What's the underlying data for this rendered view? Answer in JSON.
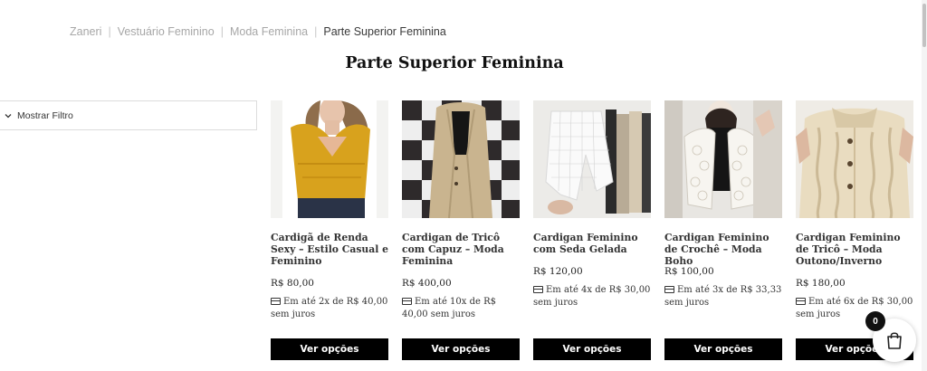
{
  "breadcrumb": {
    "items": [
      "Zaneri",
      "Vestuário Feminino",
      "Moda Feminina"
    ],
    "current": "Parte Superior Feminina",
    "separator": "|"
  },
  "page_title": "Parte Superior Feminina",
  "filter": {
    "label": "Mostrar Filtro",
    "icon": "chevron-down-icon"
  },
  "products": [
    {
      "name": "Cardigã de Renda Sexy – Estilo Casual e Feminino",
      "price": "R$ 80,00",
      "installment": "Em até 2x de R$ 40,00 sem juros",
      "button": "Ver opções"
    },
    {
      "name": "Cardigan de Tricô com Capuz – Moda Feminina",
      "price": "R$ 400,00",
      "installment": "Em até 10x de R$ 40,00 sem juros",
      "button": "Ver opções"
    },
    {
      "name": "Cardigan Feminino com Seda Gelada",
      "price": "R$ 120,00",
      "installment": "Em até 4x de R$ 30,00 sem juros",
      "button": "Ver opções"
    },
    {
      "name": "Cardigan Feminino de Crochê – Moda Boho",
      "price": "R$ 100,00",
      "installment": "Em até 3x de R$ 33,33 sem juros",
      "button": "Ver opções"
    },
    {
      "name": "Cardigan Feminino de Tricô – Moda Outono/Inverno",
      "price": "R$ 180,00",
      "installment": "Em até 6x de R$ 30,00 sem juros",
      "button": "Ver opções"
    }
  ],
  "cart": {
    "count": "0",
    "icon": "shopping-bag-icon"
  },
  "colors": {
    "button_bg": "#000000",
    "button_text": "#ffffff",
    "breadcrumb": "#a7a7a7",
    "text": "#222222"
  }
}
